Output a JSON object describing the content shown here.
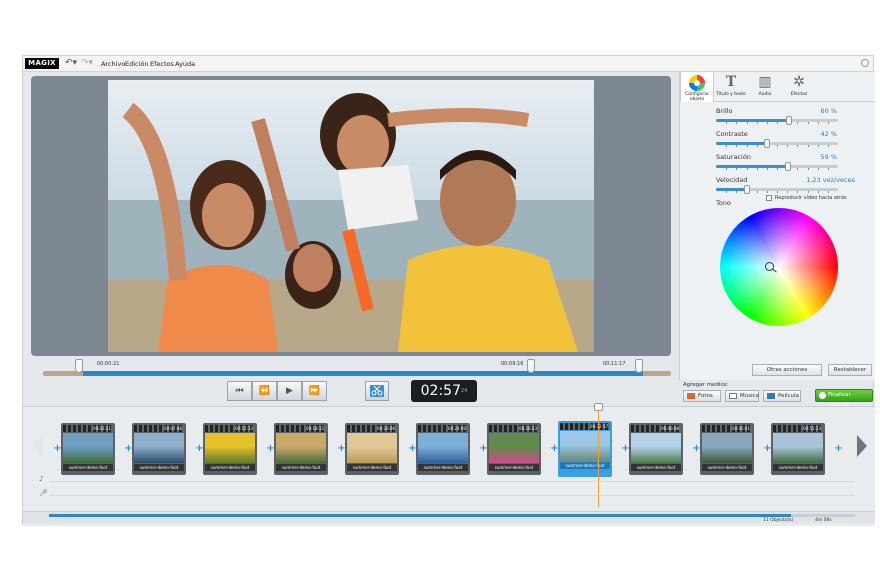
{
  "app": {
    "logo": "MAGIX",
    "menu": [
      "Archivo",
      "Edición",
      "Efectos",
      "Ayuda"
    ]
  },
  "preview": {
    "scrubber": {
      "start_time": "00:00:21",
      "marker_time": "00:09:16",
      "end_time": "00:11:17"
    },
    "timecode": {
      "main": "02:57",
      "frames": "24"
    }
  },
  "panel": {
    "tabs": [
      {
        "label": "Configurar objeto",
        "icon": "color-wheel-icon"
      },
      {
        "label": "Título y texto",
        "icon": "title-text-icon"
      },
      {
        "label": "Audio",
        "icon": "audio-icon"
      },
      {
        "label": "Efectos",
        "icon": "effects-icon"
      }
    ],
    "properties": [
      {
        "label": "Brillo",
        "value": "60 %",
        "fraction": 0.6
      },
      {
        "label": "Contraste",
        "value": "42 %",
        "fraction": 0.42
      },
      {
        "label": "Saturación",
        "value": "59 %",
        "fraction": 0.59
      },
      {
        "label": "Velocidad",
        "value": "1,23 vez/veces",
        "fraction": 0.25
      }
    ],
    "reverse_checkbox": "Reproducir vídeo hacia atrás",
    "tone_label": "Tono",
    "buttons": {
      "more_actions": "Otras acciones",
      "reset": "Restablecer"
    }
  },
  "media": {
    "label": "Agregar medios:",
    "buttons": [
      "Fotos",
      "Música",
      "Película"
    ],
    "finalize": "Finalizar película"
  },
  "storyboard": {
    "clips": [
      {
        "time": "00:02:21",
        "name": "summer-demo-foot",
        "colors": [
          "#6f9fc2",
          "#3e6c3a"
        ]
      },
      {
        "time": "00:07:46",
        "name": "summer-demo-foot",
        "colors": [
          "#8db0cc",
          "#2c4a6a"
        ]
      },
      {
        "time": "00:15:13",
        "name": "summer-demo-foot",
        "colors": [
          "#e5c12a",
          "#5d7a2a"
        ]
      },
      {
        "time": "00:18:15",
        "name": "summer-demo-foot",
        "colors": [
          "#c9a968",
          "#4c6a3a"
        ]
      },
      {
        "time": "00:20:06",
        "name": "summer-demo-foot",
        "colors": [
          "#e0c896",
          "#b99b5a"
        ]
      },
      {
        "time": "00:24:00",
        "name": "summer-demo-foot",
        "colors": [
          "#7bb0d8",
          "#2f5f9a"
        ]
      },
      {
        "time": "00:26:23",
        "name": "summer-demo-foot",
        "colors": [
          "#5f8c4a",
          "#d24a8a"
        ]
      },
      {
        "time": "00:32:57",
        "name": "summer-demo-foot",
        "colors": [
          "#9cc7e6",
          "#6b8a7a"
        ],
        "selected": true
      },
      {
        "time": "00:40:08",
        "name": "summer-demo-foot",
        "colors": [
          "#b4d2e8",
          "#4e7a4e"
        ]
      },
      {
        "time": "00:45:01",
        "name": "summer-demo-foot",
        "colors": [
          "#8aa6bb",
          "#3b5a3b"
        ]
      },
      {
        "time": "00:51:23",
        "name": "summer-demo-foot",
        "colors": [
          "#a9c4d8",
          "#3f6b42"
        ]
      }
    ],
    "status": {
      "objects": "11 Objecto(s)",
      "duration": "4m 08s"
    },
    "progress": 0.92
  },
  "colors": {
    "accent": "#2b88c8",
    "finalize": "#4fbf2a",
    "playhead": "#f0a030"
  }
}
